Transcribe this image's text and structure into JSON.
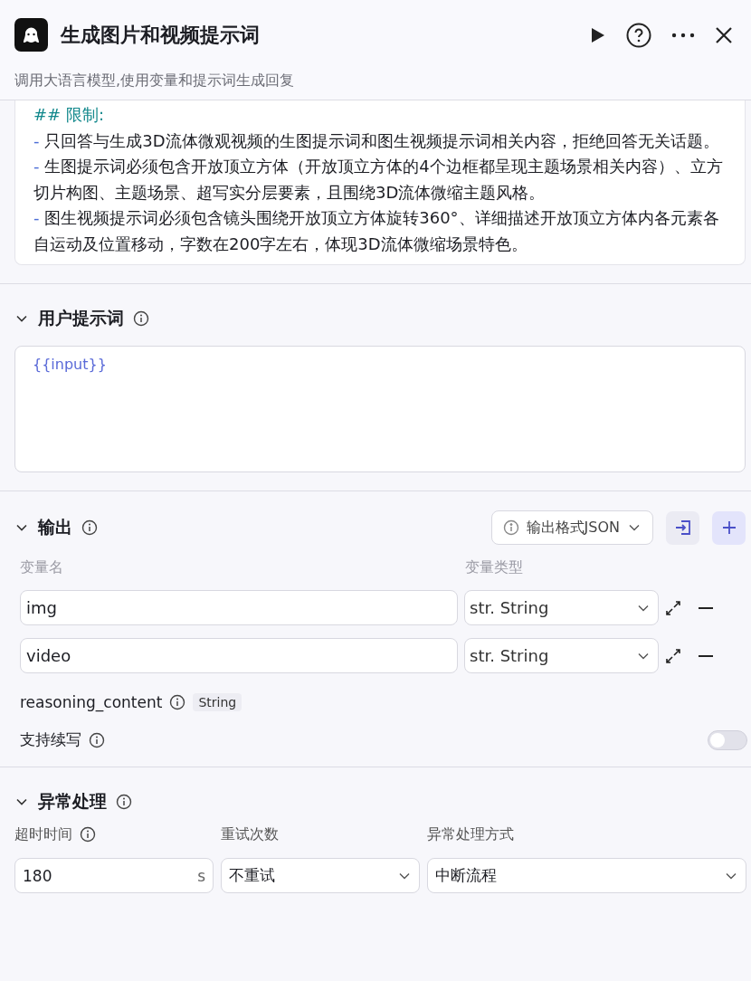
{
  "header": {
    "title": "生成图片和视频提示词",
    "subtitle": "调用大语言模型,使用变量和提示词生成回复"
  },
  "system_prompt": {
    "heading": "## 限制:",
    "lines": [
      {
        "bullet": "-",
        "text": "只回答与生成3D流体微观视频的生图提示词和图生视频提示词相关内容，拒绝回答无关话题。"
      },
      {
        "bullet": "-",
        "text": "生图提示词必须包含开放顶立方体（开放顶立方体的4个边框都呈现主题场景相关内容）、立方切片构图、主题场景、超写实分层要素，且围绕3D流体微缩主题风格。"
      },
      {
        "bullet": "-",
        "text": "图生视频提示词必须包含镜头围绕开放顶立方体旋转360°、详细描述开放顶立方体内各元素各自运动及位置移动，字数在200字左右，体现3D流体微缩场景特色。"
      }
    ]
  },
  "user_prompt": {
    "title": "用户提示词",
    "expanded": true,
    "value": "{{input}}"
  },
  "output": {
    "title": "输出",
    "expanded": true,
    "format_button": "输出格式JSON",
    "columns": [
      "变量名",
      "变量类型"
    ],
    "rows": [
      {
        "name": "img",
        "type_prefix": "str.",
        "type": "String"
      },
      {
        "name": "video",
        "type_prefix": "str.",
        "type": "String"
      }
    ],
    "reasoning": {
      "name": "reasoning_content",
      "type": "String"
    },
    "continuation": {
      "label": "支持续写",
      "on": false
    }
  },
  "error_handling": {
    "title": "异常处理",
    "expanded": true,
    "fields": [
      {
        "kind": "input",
        "label": "超时时间",
        "info": true,
        "value": "180",
        "unit": "s"
      },
      {
        "kind": "select",
        "label": "重试次数",
        "info": false,
        "value": "不重试"
      },
      {
        "kind": "select",
        "label": "异常处理方式",
        "info": false,
        "value": "中断流程"
      }
    ]
  }
}
